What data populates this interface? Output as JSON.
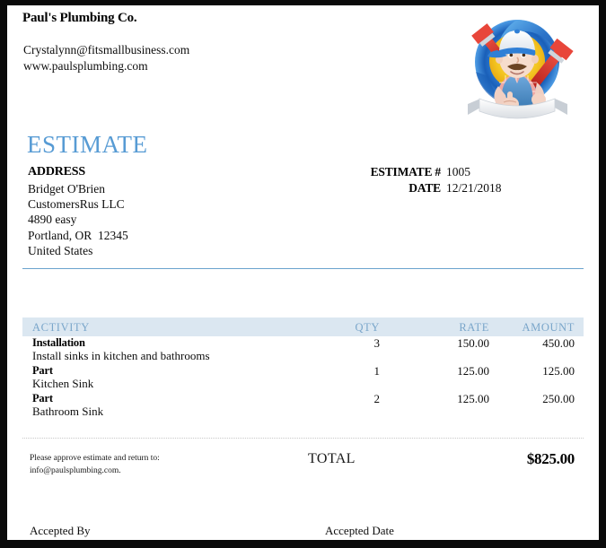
{
  "document": {
    "company_name": "Paul's Plumbing Co.",
    "contact_email": "Crystalynn@fitsmallbusiness.com",
    "contact_website": "www.paulsplumbing.com",
    "title": "ESTIMATE",
    "logo_alt": "plumber-mascot-logo"
  },
  "address": {
    "label": "ADDRESS",
    "lines": [
      "Bridget O'Brien",
      "CustomersRus LLC",
      "4890 easy",
      "Portland, OR  12345",
      "United States"
    ]
  },
  "meta": {
    "estimate_number_label": "ESTIMATE #",
    "estimate_number_value": "1005",
    "date_label": "DATE",
    "date_value": "12/21/2018"
  },
  "table": {
    "headers": {
      "activity": "ACTIVITY",
      "qty": "QTY",
      "rate": "RATE",
      "amount": "AMOUNT"
    },
    "rows": [
      {
        "name": "Installation",
        "description": "Install sinks in kitchen and bathrooms",
        "qty": "3",
        "rate": "150.00",
        "amount": "450.00"
      },
      {
        "name": "Part",
        "description": "Kitchen Sink",
        "qty": "1",
        "rate": "125.00",
        "amount": "125.00"
      },
      {
        "name": "Part",
        "description": "Bathroom Sink",
        "qty": "2",
        "rate": "125.00",
        "amount": "250.00"
      }
    ]
  },
  "totals": {
    "approve_note_line1": "Please approve estimate and return to:",
    "approve_note_line2": "info@paulsplumbing.com.",
    "total_label": "TOTAL",
    "total_value": "$825.00"
  },
  "footer": {
    "accepted_by": "Accepted By",
    "accepted_date": "Accepted Date"
  },
  "colors": {
    "accent_blue": "#579bd4",
    "rule_blue": "#6ba3ce",
    "table_header_bg": "#dbe7f1",
    "table_header_text": "#7aa6ca",
    "frame": "#0a0a0a"
  }
}
